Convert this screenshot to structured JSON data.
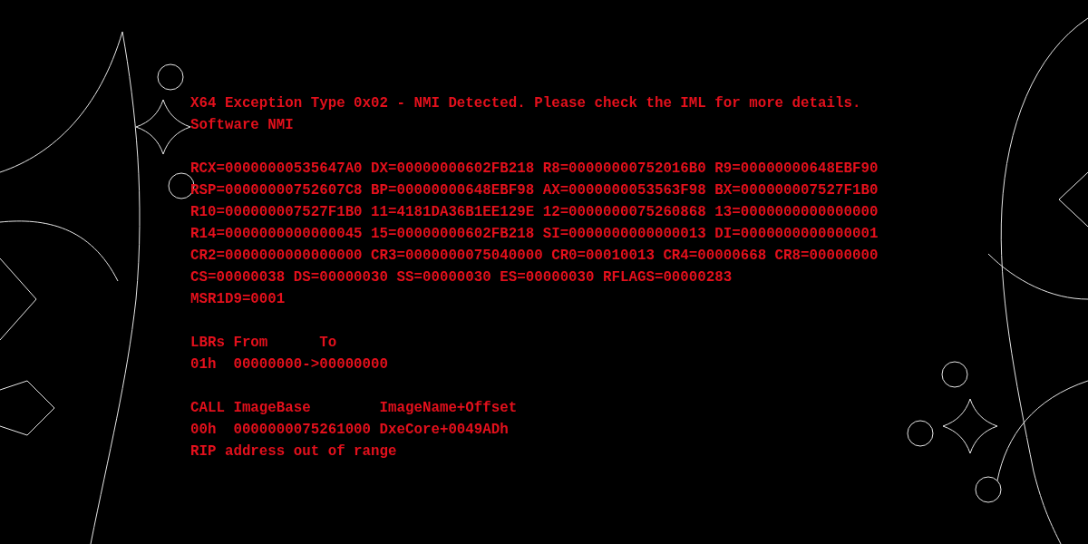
{
  "sections": [
    {
      "lines": [
        "X64 Exception Type 0x02 - NMI Detected. Please check the IML for more details.",
        "Software NMI"
      ]
    },
    {
      "lines": [
        "RCX=00000000535647A0 DX=00000000602FB218 R8=00000000752016B0 R9=00000000648EBF90",
        "RSP=00000000752607C8 BP=00000000648EBF98 AX=0000000053563F98 BX=000000007527F1B0",
        "R10=000000007527F1B0 11=4181DA36B1EE129E 12=0000000075260868 13=0000000000000000",
        "R14=0000000000000045 15=00000000602FB218 SI=0000000000000013 DI=0000000000000001",
        "CR2=0000000000000000 CR3=0000000075040000 CR0=00010013 CR4=00000668 CR8=00000000",
        "CS=00000038 DS=00000030 SS=00000030 ES=00000030 RFLAGS=00000283",
        "MSR1D9=0001"
      ]
    },
    {
      "lines": [
        "LBRs From      To",
        "01h  00000000->00000000"
      ]
    },
    {
      "lines": [
        "CALL ImageBase        ImageName+Offset",
        "00h  0000000075261000 DxeCore+0049ADh",
        "RIP address out of range"
      ]
    }
  ]
}
